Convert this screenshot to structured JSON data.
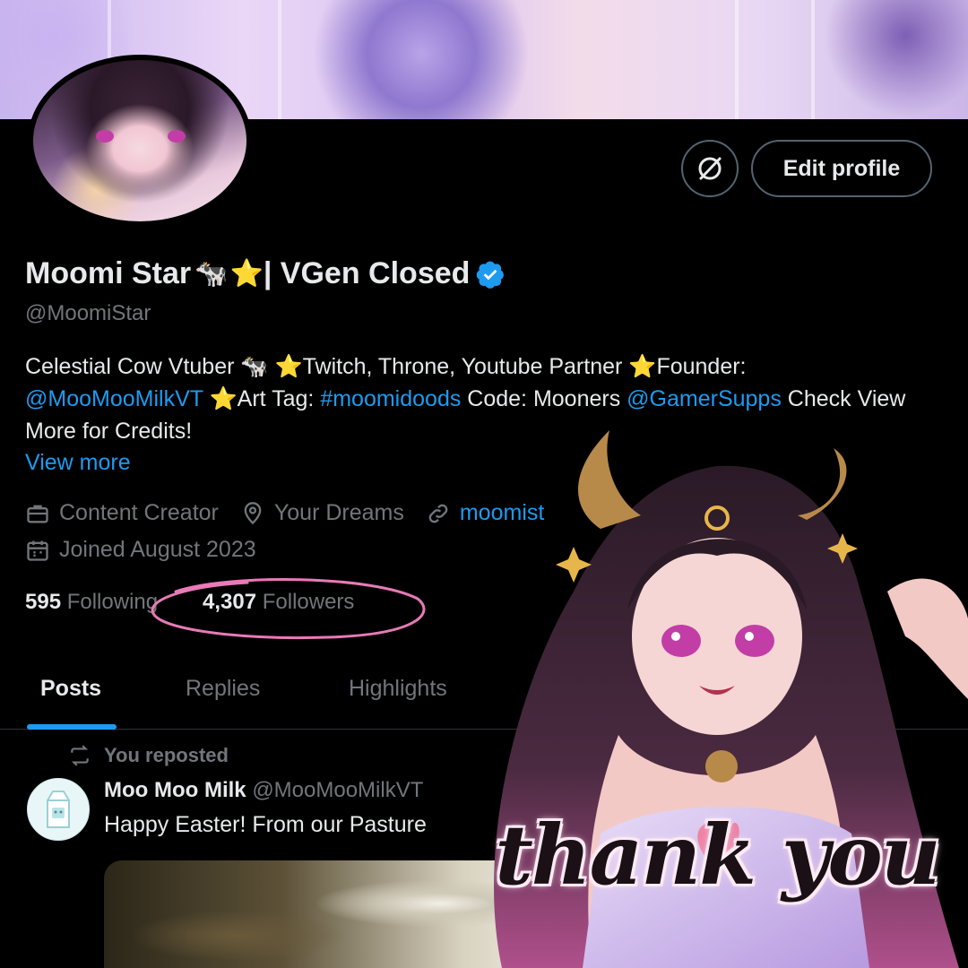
{
  "profile": {
    "display_name": "Moomi Star",
    "name_emoji_cow": "🐄",
    "name_emoji_star": "⭐",
    "name_suffix": "| VGen Closed",
    "handle": "@MoomiStar",
    "edit_profile_label": "Edit profile"
  },
  "bio": {
    "t1": "Celestial Cow Vtuber ",
    "cow": "🐄",
    "t2": " ",
    "star1": "⭐",
    "t3": "Twitch, Throne, Youtube Partner ",
    "star2": "⭐",
    "t4": "Founder:",
    "mention1": "@MooMooMilkVT",
    "t5": " ",
    "star3": "⭐",
    "t6": "Art Tag: ",
    "hashtag": "#moomidoods",
    "t7": " Code: Mooners ",
    "mention2": "@GamerSupps",
    "t8": " Check View More for Credits!",
    "view_more": "View more"
  },
  "meta": {
    "category": "Content Creator",
    "location": "Your Dreams",
    "website": "moomist",
    "joined": "Joined August 2023"
  },
  "stats": {
    "following_count": "595",
    "following_label": "Following",
    "followers_count": "4,307",
    "followers_label": "Followers"
  },
  "tabs": [
    "Posts",
    "Replies",
    "Highlights"
  ],
  "post": {
    "repost_label": "You reposted",
    "author_name": "Moo Moo Milk",
    "author_handle": "@MooMooMilkVT",
    "text": "Happy Easter! From our Pasture"
  },
  "overlay": {
    "thank_you": "thank you"
  },
  "colors": {
    "background": "#000000",
    "link": "#1d9bf0",
    "muted": "#71767b",
    "text": "#e7e9ea",
    "highlight_circle": "#e97ab8"
  }
}
